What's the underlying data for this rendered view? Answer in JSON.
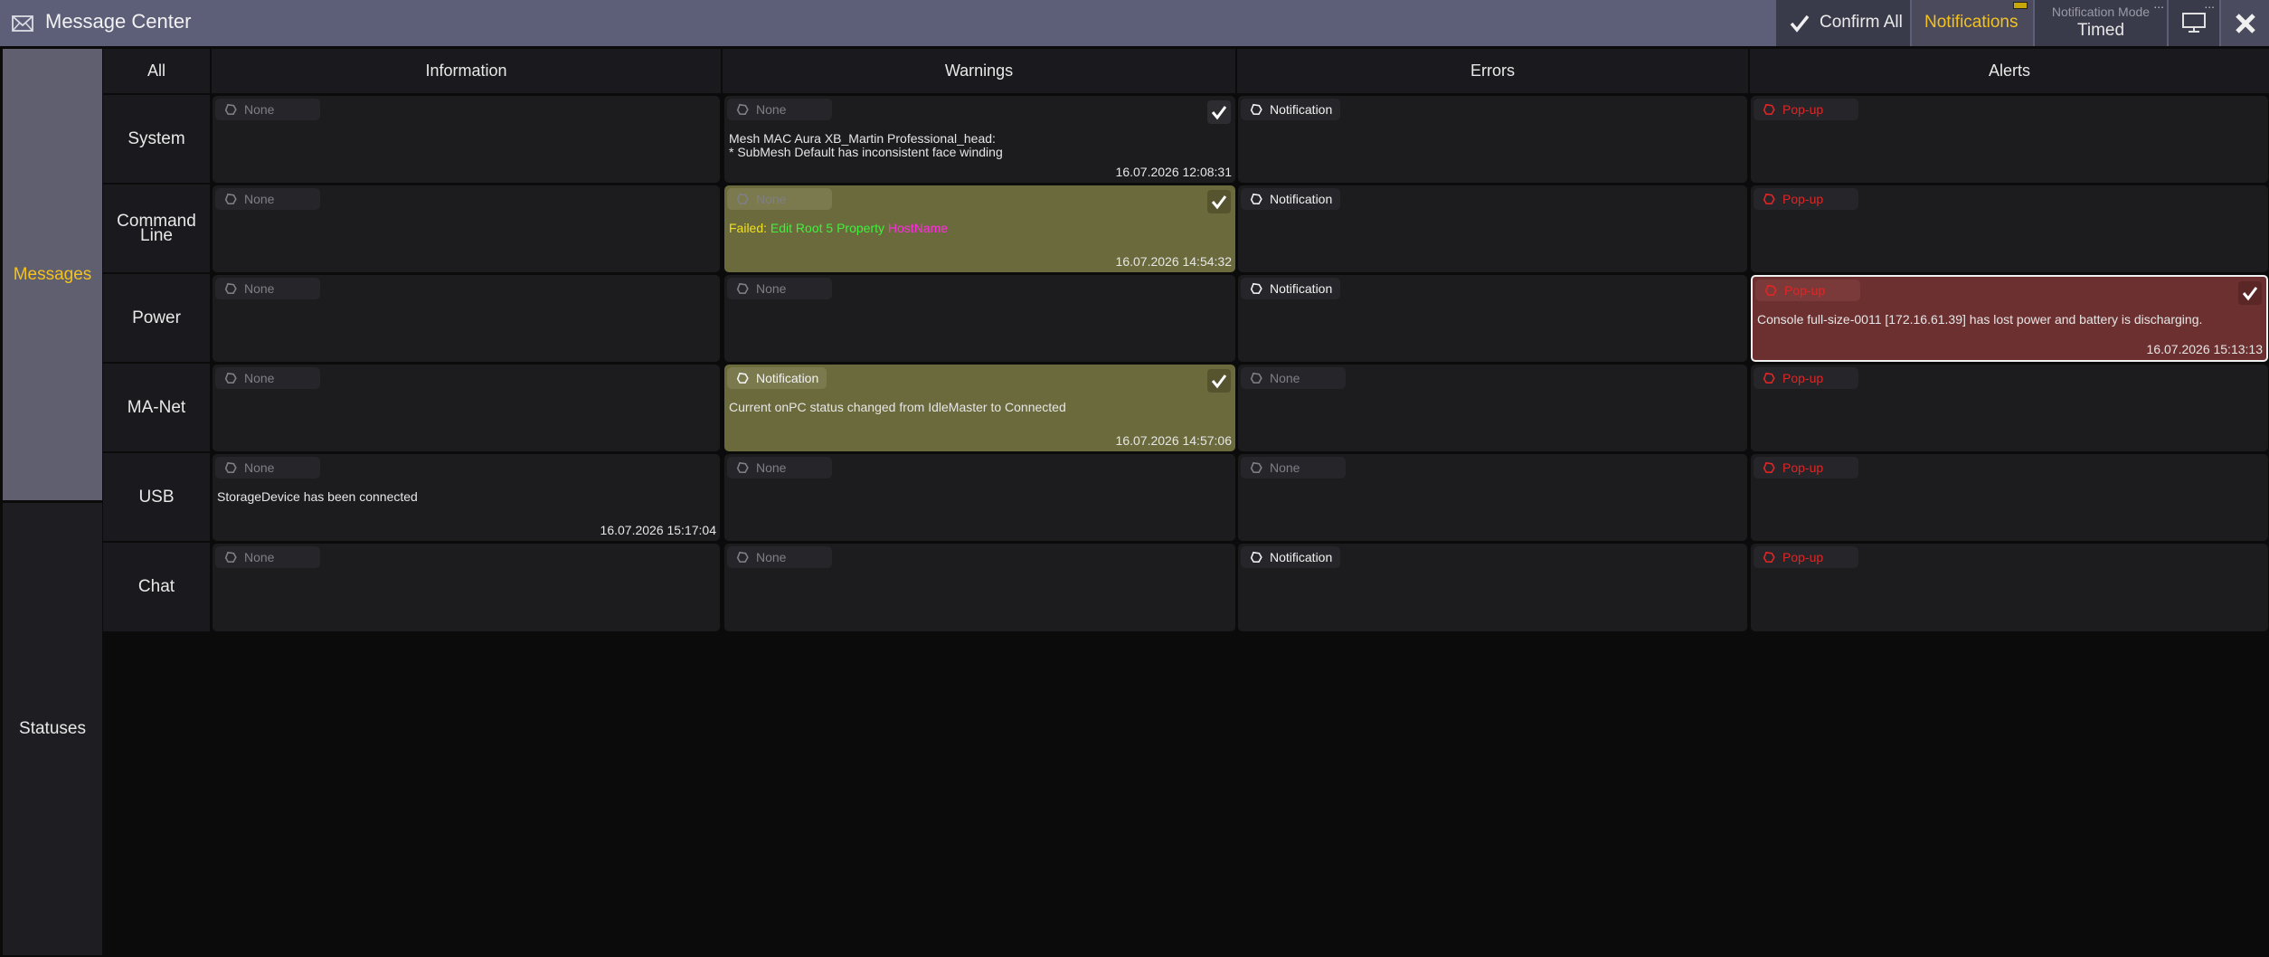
{
  "window": {
    "title": "Message Center",
    "icon": "envelope-icon"
  },
  "toolbar": {
    "confirm_all_label": "Confirm All",
    "notifications_label": "Notifications",
    "mode_caption": "Notification Mode",
    "mode_value": "Timed",
    "ellipsis": "..."
  },
  "side_tabs": {
    "messages": "Messages",
    "statuses": "Statuses",
    "active": "Messages"
  },
  "columns": [
    "All",
    "Information",
    "Warnings",
    "Errors",
    "Alerts"
  ],
  "rows": [
    "System",
    "Command Line",
    "Power",
    "MA-Net",
    "USB",
    "Chat"
  ],
  "cells": [
    [
      {
        "chip": "None"
      },
      {
        "chip": "None",
        "acked": true,
        "msg": [
          "Mesh MAC Aura XB_Martin Professional_head:",
          "* SubMesh Default has inconsistent face winding"
        ],
        "ts": "16.07.2026 12:08:31"
      },
      {
        "chip": "Notification"
      },
      {
        "chip": "Pop-up"
      }
    ],
    [
      {
        "chip": "None"
      },
      {
        "chip": "None",
        "acked": true,
        "highlight": "warning",
        "msg_parts": [
          "Failed:",
          "Edit Root",
          "5",
          "Property",
          "HostName"
        ],
        "ts": "16.07.2026 14:54:32"
      },
      {
        "chip": "Notification"
      },
      {
        "chip": "Pop-up"
      }
    ],
    [
      {
        "chip": "None"
      },
      {
        "chip": "None"
      },
      {
        "chip": "Notification"
      },
      {
        "chip": "Pop-up",
        "acked": true,
        "highlight": "alert",
        "msg": [
          "Console full-size-0011 [172.16.61.39] has lost power and battery is discharging."
        ],
        "ts": "16.07.2026 15:13:13"
      }
    ],
    [
      {
        "chip": "None"
      },
      {
        "chip": "Notification",
        "acked": true,
        "highlight": "warning",
        "msg": [
          "Current onPC status changed from IdleMaster to Connected"
        ],
        "ts": "16.07.2026 14:57:06"
      },
      {
        "chip": "None"
      },
      {
        "chip": "Pop-up"
      }
    ],
    [
      {
        "chip": "None",
        "msg": [
          "StorageDevice has been connected"
        ],
        "ts": "16.07.2026 15:17:04"
      },
      {
        "chip": "None"
      },
      {
        "chip": "None"
      },
      {
        "chip": "Pop-up"
      }
    ],
    [
      {
        "chip": "None"
      },
      {
        "chip": "None"
      },
      {
        "chip": "Notification"
      },
      {
        "chip": "Pop-up"
      }
    ]
  ],
  "colors": {
    "accent_yellow": "#f3c21f",
    "popup_red": "#e22525",
    "warning_highlight": "#6b6a3c",
    "alert_highlight": "#6c3030",
    "titlebar": "#5d5e78"
  }
}
